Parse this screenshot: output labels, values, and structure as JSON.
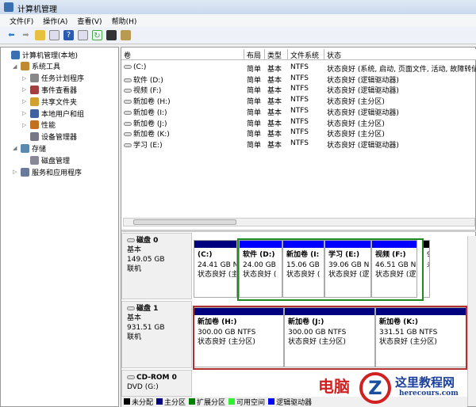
{
  "window": {
    "title": "计算机管理"
  },
  "menu": [
    "文件(F)",
    "操作(A)",
    "查看(V)",
    "帮助(H)"
  ],
  "tree": [
    {
      "label": "计算机管理(本地)",
      "level": 0,
      "arrow": ""
    },
    {
      "label": "系统工具",
      "level": 1,
      "arrow": "◢"
    },
    {
      "label": "任务计划程序",
      "level": 2,
      "arrow": "▷"
    },
    {
      "label": "事件查看器",
      "level": 2,
      "arrow": "▷"
    },
    {
      "label": "共享文件夹",
      "level": 2,
      "arrow": "▷"
    },
    {
      "label": "本地用户和组",
      "level": 2,
      "arrow": "▷"
    },
    {
      "label": "性能",
      "level": 2,
      "arrow": "▷"
    },
    {
      "label": "设备管理器",
      "level": 2,
      "arrow": ""
    },
    {
      "label": "存储",
      "level": 1,
      "arrow": "◢"
    },
    {
      "label": "磁盘管理",
      "level": 2,
      "arrow": ""
    },
    {
      "label": "服务和应用程序",
      "level": 1,
      "arrow": "▷"
    }
  ],
  "table": {
    "columns": [
      "卷",
      "布局",
      "类型",
      "文件系统",
      "状态"
    ],
    "rows": [
      [
        "(C:)",
        "简单",
        "基本",
        "NTFS",
        "状态良好 (系统, 启动, 页面文件, 活动, 故障转储"
      ],
      [
        "软件 (D:)",
        "简单",
        "基本",
        "NTFS",
        "状态良好 (逻辑驱动器)"
      ],
      [
        "视频 (F:)",
        "简单",
        "基本",
        "NTFS",
        "状态良好 (逻辑驱动器)"
      ],
      [
        "新加卷 (H:)",
        "简单",
        "基本",
        "NTFS",
        "状态良好 (主分区)"
      ],
      [
        "新加卷 (I:)",
        "简单",
        "基本",
        "NTFS",
        "状态良好 (逻辑驱动器)"
      ],
      [
        "新加卷 (J:)",
        "简单",
        "基本",
        "NTFS",
        "状态良好 (主分区)"
      ],
      [
        "新加卷 (K:)",
        "简单",
        "基本",
        "NTFS",
        "状态良好 (主分区)"
      ],
      [
        "学习 (E:)",
        "简单",
        "基本",
        "NTFS",
        "状态良好 (逻辑驱动器)"
      ]
    ]
  },
  "disks": [
    {
      "name": "磁盘 0",
      "type": "基本",
      "size": "149.05 GB",
      "status": "联机",
      "partitions": [
        {
          "name": "(C:)",
          "size": "24.41 GB N",
          "status": "状态良好 (主"
        },
        {
          "name": "软件  (D:)",
          "size": "24.00 GB",
          "status": "状态良好 ("
        },
        {
          "name": "新加卷  (I:",
          "size": "15.06 GB",
          "status": "状态良好 ("
        },
        {
          "name": "学习  (E:)",
          "size": "39.06 GB N",
          "status": "状态良好 (逻"
        },
        {
          "name": "视频  (F:)",
          "size": "46.51 GB N",
          "status": "状态良好 (逻"
        },
        {
          "name": "",
          "size": "9",
          "status": "未"
        }
      ]
    },
    {
      "name": "磁盘 1",
      "type": "基本",
      "size": "931.51 GB",
      "status": "联机",
      "partitions": [
        {
          "name": "新加卷  (H:)",
          "size": "300.00 GB NTFS",
          "status": "状态良好 (主分区)"
        },
        {
          "name": "新加卷  (J:)",
          "size": "300.00 GB NTFS",
          "status": "状态良好 (主分区)"
        },
        {
          "name": "新加卷  (K:)",
          "size": "331.51 GB NTFS",
          "status": "状态良好 (主分区)"
        }
      ]
    },
    {
      "name": "CD-ROM 0",
      "type": "DVD (G:)"
    }
  ],
  "legend": [
    {
      "label": "未分配",
      "color": "#000000"
    },
    {
      "label": "主分区",
      "color": "#00007f"
    },
    {
      "label": "扩展分区",
      "color": "#008000"
    },
    {
      "label": "可用空间",
      "color": "#33ee33"
    },
    {
      "label": "逻辑驱动器",
      "color": "#0000ff"
    }
  ],
  "watermark": {
    "text1": "电脑",
    "text2": "这里教程网",
    "text3": "herecours.com"
  }
}
